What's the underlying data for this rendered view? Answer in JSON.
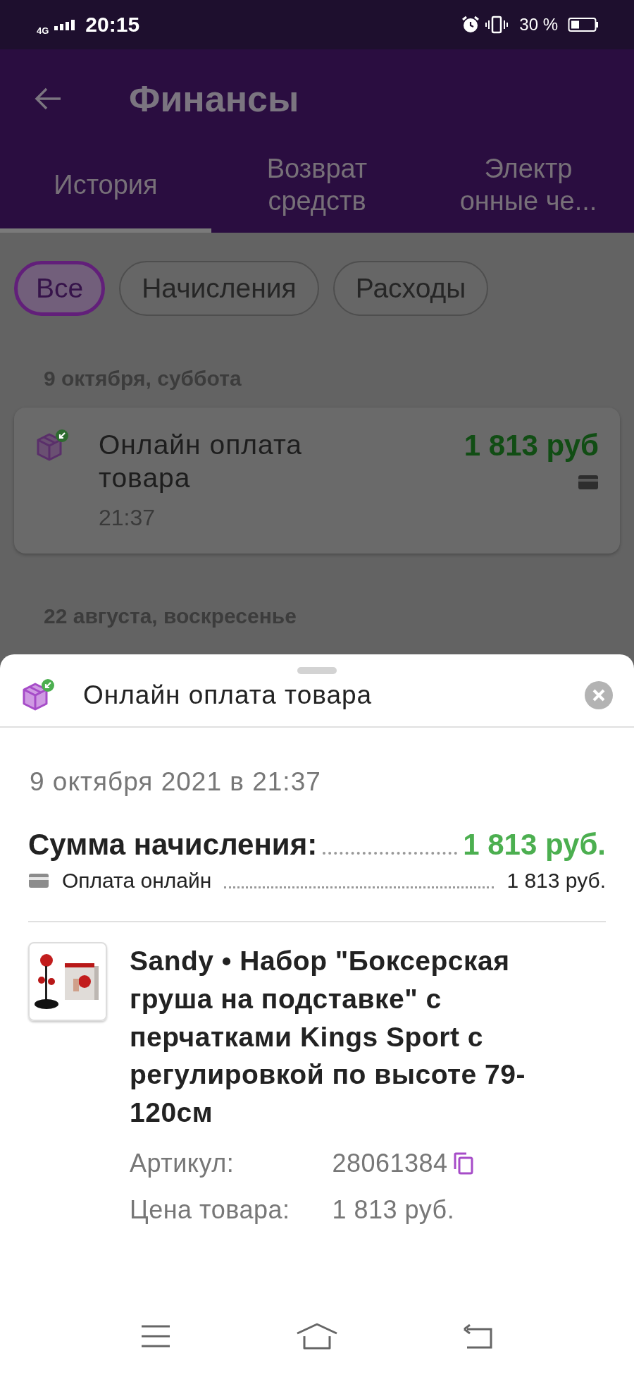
{
  "status_bar": {
    "network": "4G",
    "time": "20:15",
    "battery": "30 %"
  },
  "header": {
    "title": "Финансы"
  },
  "tabs": [
    {
      "lines": [
        "История"
      ],
      "selected": true
    },
    {
      "lines": [
        "Возврат",
        "средств"
      ],
      "selected": false
    },
    {
      "lines": [
        "Электр",
        "онные че..."
      ],
      "selected": false
    }
  ],
  "filters": [
    {
      "label": "Все",
      "selected": true
    },
    {
      "label": "Начисления",
      "selected": false
    },
    {
      "label": "Расходы",
      "selected": false
    }
  ],
  "history": [
    {
      "date": "9 октября, суббота",
      "items": [
        {
          "title": "Онлайн оплата товара",
          "time": "21:37",
          "amount": "1 813 руб"
        }
      ]
    },
    {
      "date": "22 августа, воскресенье"
    }
  ],
  "detail_sheet": {
    "title": "Онлайн оплата товара",
    "datetime": "9 октября 2021 в 21:37",
    "total_label": "Сумма начисления:",
    "total_amount": "1 813 руб.",
    "payments": [
      {
        "label": "Оплата онлайн",
        "amount": "1 813 руб."
      }
    ],
    "product": {
      "name": "Sandy • Набор \"Боксерская груша на подставке\" с перчатками Kings Sport с регулировкой по высоте 79-120см",
      "fields": [
        {
          "label": "Артикул:",
          "value": "28061384",
          "kind": "copyable"
        },
        {
          "label": "Цена товара:",
          "value": "1 813 руб.",
          "kind": "text"
        }
      ]
    }
  }
}
